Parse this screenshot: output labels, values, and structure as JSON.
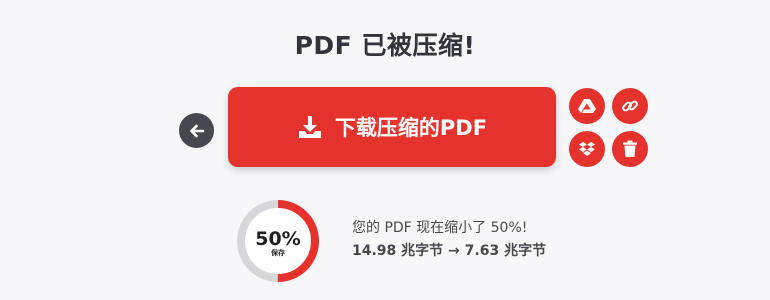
{
  "header": {
    "title": "PDF 已被压缩!"
  },
  "actions": {
    "download_label": "下载压缩的PDF",
    "icons": {
      "back": "arrow-left-icon",
      "download": "download-icon",
      "drive": "google-drive-icon",
      "link": "link-icon",
      "dropbox": "dropbox-icon",
      "delete": "trash-icon"
    }
  },
  "result": {
    "percent_label": "50%",
    "percent_value": 50,
    "saved_label": "保存",
    "message": "您的 PDF 现在缩小了 50%!",
    "size_before": "14.98 兆字节",
    "arrow": "→",
    "size_after": "7.63 兆字节"
  },
  "colors": {
    "accent": "#e5322d",
    "ring_track": "#d6d6db",
    "back_button": "#47474f",
    "text": "#33333b"
  }
}
